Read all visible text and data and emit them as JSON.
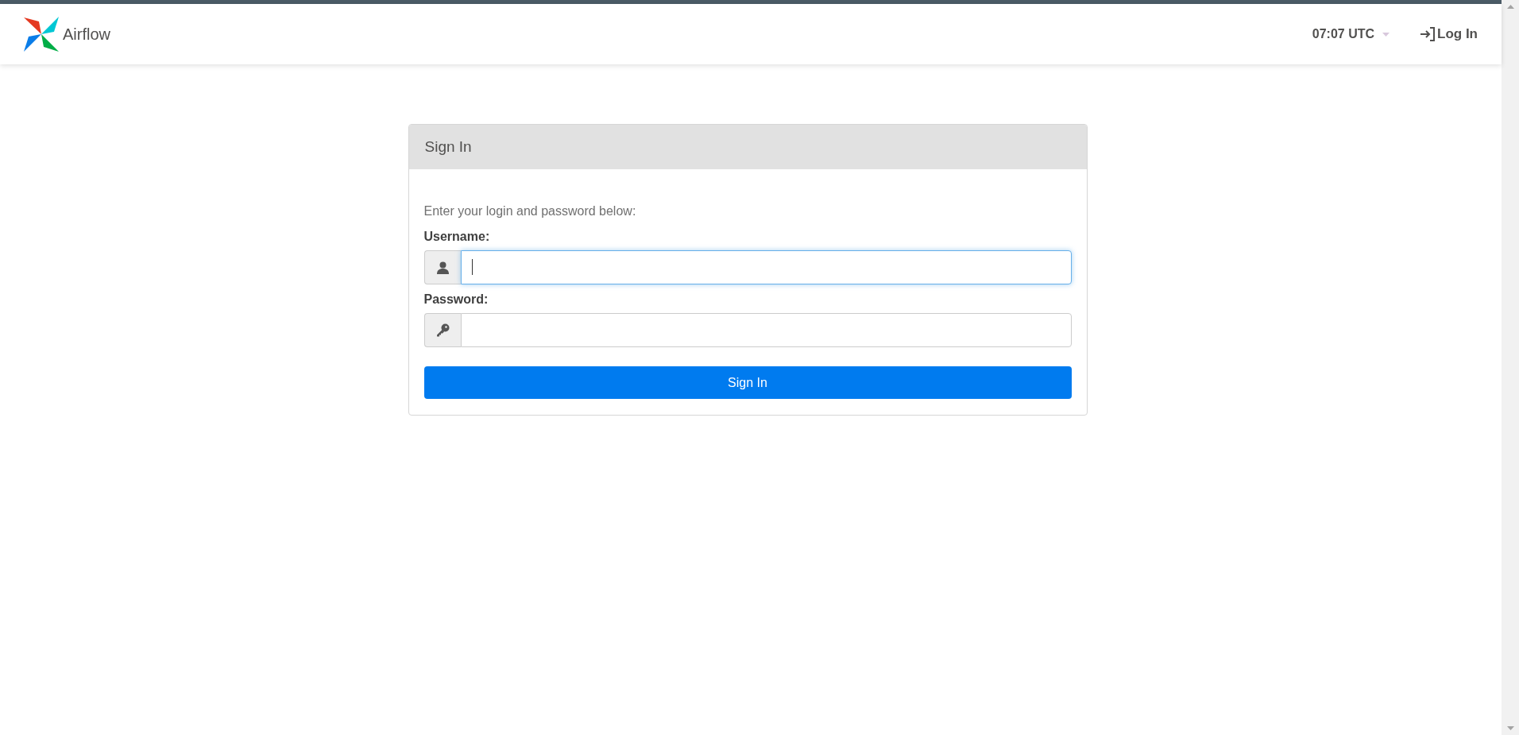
{
  "navbar": {
    "brand": "Airflow",
    "clock": "07:07 UTC",
    "login_link": "Log In"
  },
  "sign_in_card": {
    "title": "Sign In",
    "intro": "Enter your login and password below:",
    "fields": [
      {
        "kind": "user",
        "label": "Username:",
        "focused": true
      },
      {
        "kind": "key",
        "label": "Password:",
        "focused": false
      }
    ],
    "submit": "Sign In"
  }
}
